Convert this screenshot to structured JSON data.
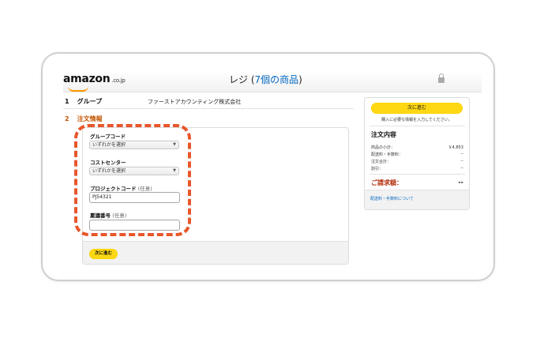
{
  "header": {
    "logo_text": "amazon",
    "logo_tld": ".co.jp",
    "title": "レジ (",
    "item_count": "7個の商品",
    "title_close": ")"
  },
  "steps": [
    {
      "number": "1",
      "title": "グループ",
      "value": "ファーストアカウンティング株式会社"
    },
    {
      "number": "2",
      "title": "注文情報"
    }
  ],
  "form": {
    "group_code": {
      "label": "グループコード",
      "value": "いずれかを選択"
    },
    "cost_center": {
      "label": "コストセンター",
      "value": "いずれかを選択"
    },
    "project_code": {
      "label": "プロジェクトコード",
      "optional": "(任意)",
      "value": "PJ54321"
    },
    "approval_number": {
      "label": "稟議番号",
      "optional": "(任意)",
      "value": ""
    },
    "next_label": "次に進む"
  },
  "summary": {
    "next_label": "次に進む",
    "note": "購入に必要な情報を入力してください。",
    "title": "注文内容",
    "rows": [
      {
        "label": "商品の小計：",
        "value": "￥4,853"
      },
      {
        "label": "配送料・手数料：",
        "value": "--"
      },
      {
        "label": "注文合計：",
        "value": "--"
      },
      {
        "label": "割引：",
        "value": "--"
      }
    ],
    "total_label": "ご請求額：",
    "total_value": "--",
    "footer_link": "配送料・手数料について"
  },
  "colors": {
    "accent_button": "#ffd814",
    "highlight_dash": "#e8562a",
    "step_active": "#c45500",
    "total_red": "#b12704",
    "link_blue": "#0066c0"
  },
  "icons": [
    "lock-icon",
    "chevron-down-icon",
    "amazon-smile-icon"
  ]
}
